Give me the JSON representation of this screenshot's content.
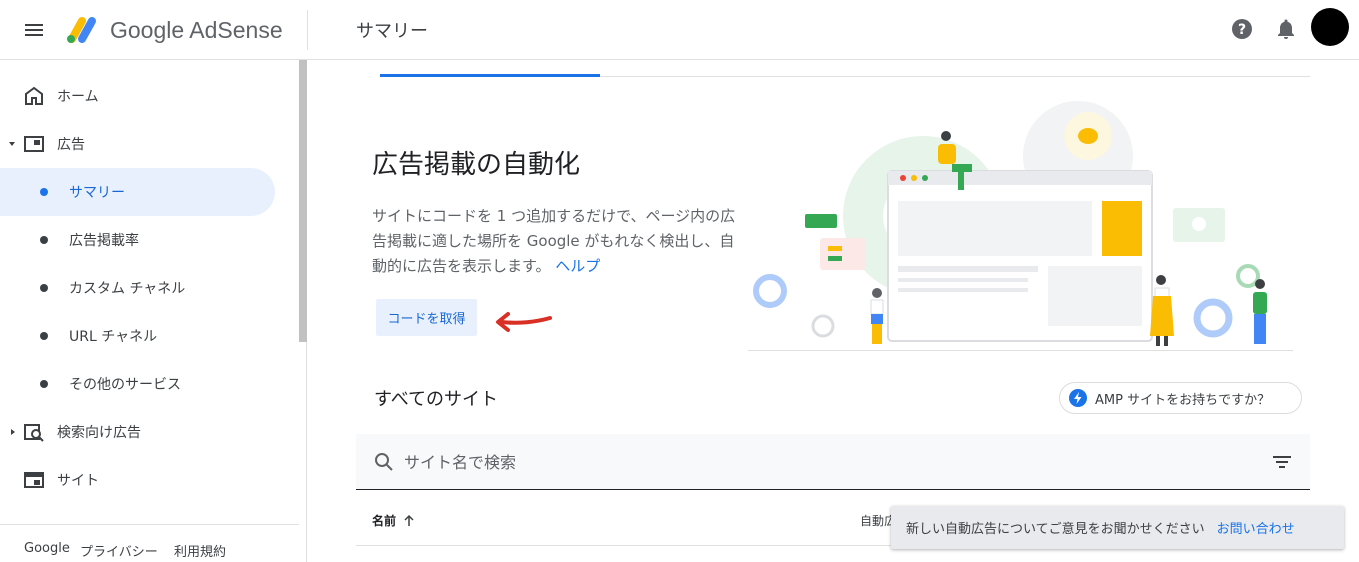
{
  "app": {
    "logo_text": "Google AdSense",
    "page_title": "サマリー"
  },
  "sidebar": {
    "items": [
      {
        "label": "ホーム",
        "icon": "home-icon"
      },
      {
        "label": "広告",
        "icon": "ads-icon"
      },
      {
        "label": "サマリー"
      },
      {
        "label": "広告掲載率"
      },
      {
        "label": "カスタム チャネル"
      },
      {
        "label": "URL チャネル"
      },
      {
        "label": "その他のサービス"
      },
      {
        "label": "検索向け広告",
        "icon": "search-ads-icon"
      },
      {
        "label": "サイト",
        "icon": "sites-icon"
      }
    ],
    "footer": {
      "google": "Google",
      "privacy": "プライバシー",
      "terms": "利用規約"
    }
  },
  "main": {
    "headline": "広告掲載の自動化",
    "description": "サイトにコードを 1 つ追加するだけで、ページ内の広告掲載に適した場所を Google がもれなく検出し、自動的に広告を表示します。",
    "help_link": "ヘルプ",
    "get_code_button": "コードを取得",
    "all_sites_title": "すべてのサイト",
    "amp_button": "AMP サイトをお持ちですか？",
    "search_placeholder": "サイト名で検索",
    "table": {
      "col_name": "名前",
      "col_auto": "自動広"
    }
  },
  "snackbar": {
    "message": "新しい自動広告についてご意見をお聞かせください",
    "action": "お問い合わせ"
  },
  "colors": {
    "accent": "#1a73e8",
    "active_bg": "#e8f0fe",
    "arrow": "#d93025"
  }
}
